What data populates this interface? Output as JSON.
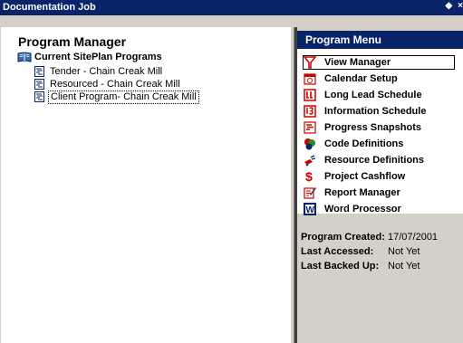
{
  "window": {
    "title": "Documentation Job",
    "controls": [
      "◆",
      "×"
    ]
  },
  "left": {
    "title": "Program Manager",
    "tree": {
      "root_label": "Current SitePlan Programs",
      "items": [
        {
          "label": "Tender - Chain Creak Mill",
          "selected": false
        },
        {
          "label": "Resourced - Chain Creak Mill",
          "selected": false
        },
        {
          "label": "Client Program- Chain Creak Mill",
          "selected": true
        }
      ]
    }
  },
  "menu": {
    "title": "Program Menu",
    "items": [
      {
        "label": "View Manager",
        "icon": "view-manager-icon"
      },
      {
        "label": "Calendar Setup",
        "icon": "calendar-icon"
      },
      {
        "label": "Long Lead Schedule",
        "icon": "long-lead-icon"
      },
      {
        "label": "Information Schedule",
        "icon": "information-schedule-icon"
      },
      {
        "label": "Progress Snapshots",
        "icon": "progress-snapshots-icon"
      },
      {
        "label": "Code Definitions",
        "icon": "code-definitions-icon"
      },
      {
        "label": "Resource Definitions",
        "icon": "resource-definitions-icon"
      },
      {
        "label": "Project Cashflow",
        "icon": "dollar-icon"
      },
      {
        "label": "Report Manager",
        "icon": "report-manager-icon"
      },
      {
        "label": "Word Processor",
        "icon": "word-processor-icon"
      }
    ]
  },
  "info": {
    "created_label": "Program Created:",
    "created_value": "17/07/2001",
    "accessed_label": "Last Accessed:",
    "accessed_value": "Not Yet",
    "backed_label": "Last Backed Up:",
    "backed_value": "Not Yet"
  },
  "colors": {
    "titlebar": "#0a246a",
    "face": "#d4d0c8",
    "accent_red": "#cc0000"
  }
}
